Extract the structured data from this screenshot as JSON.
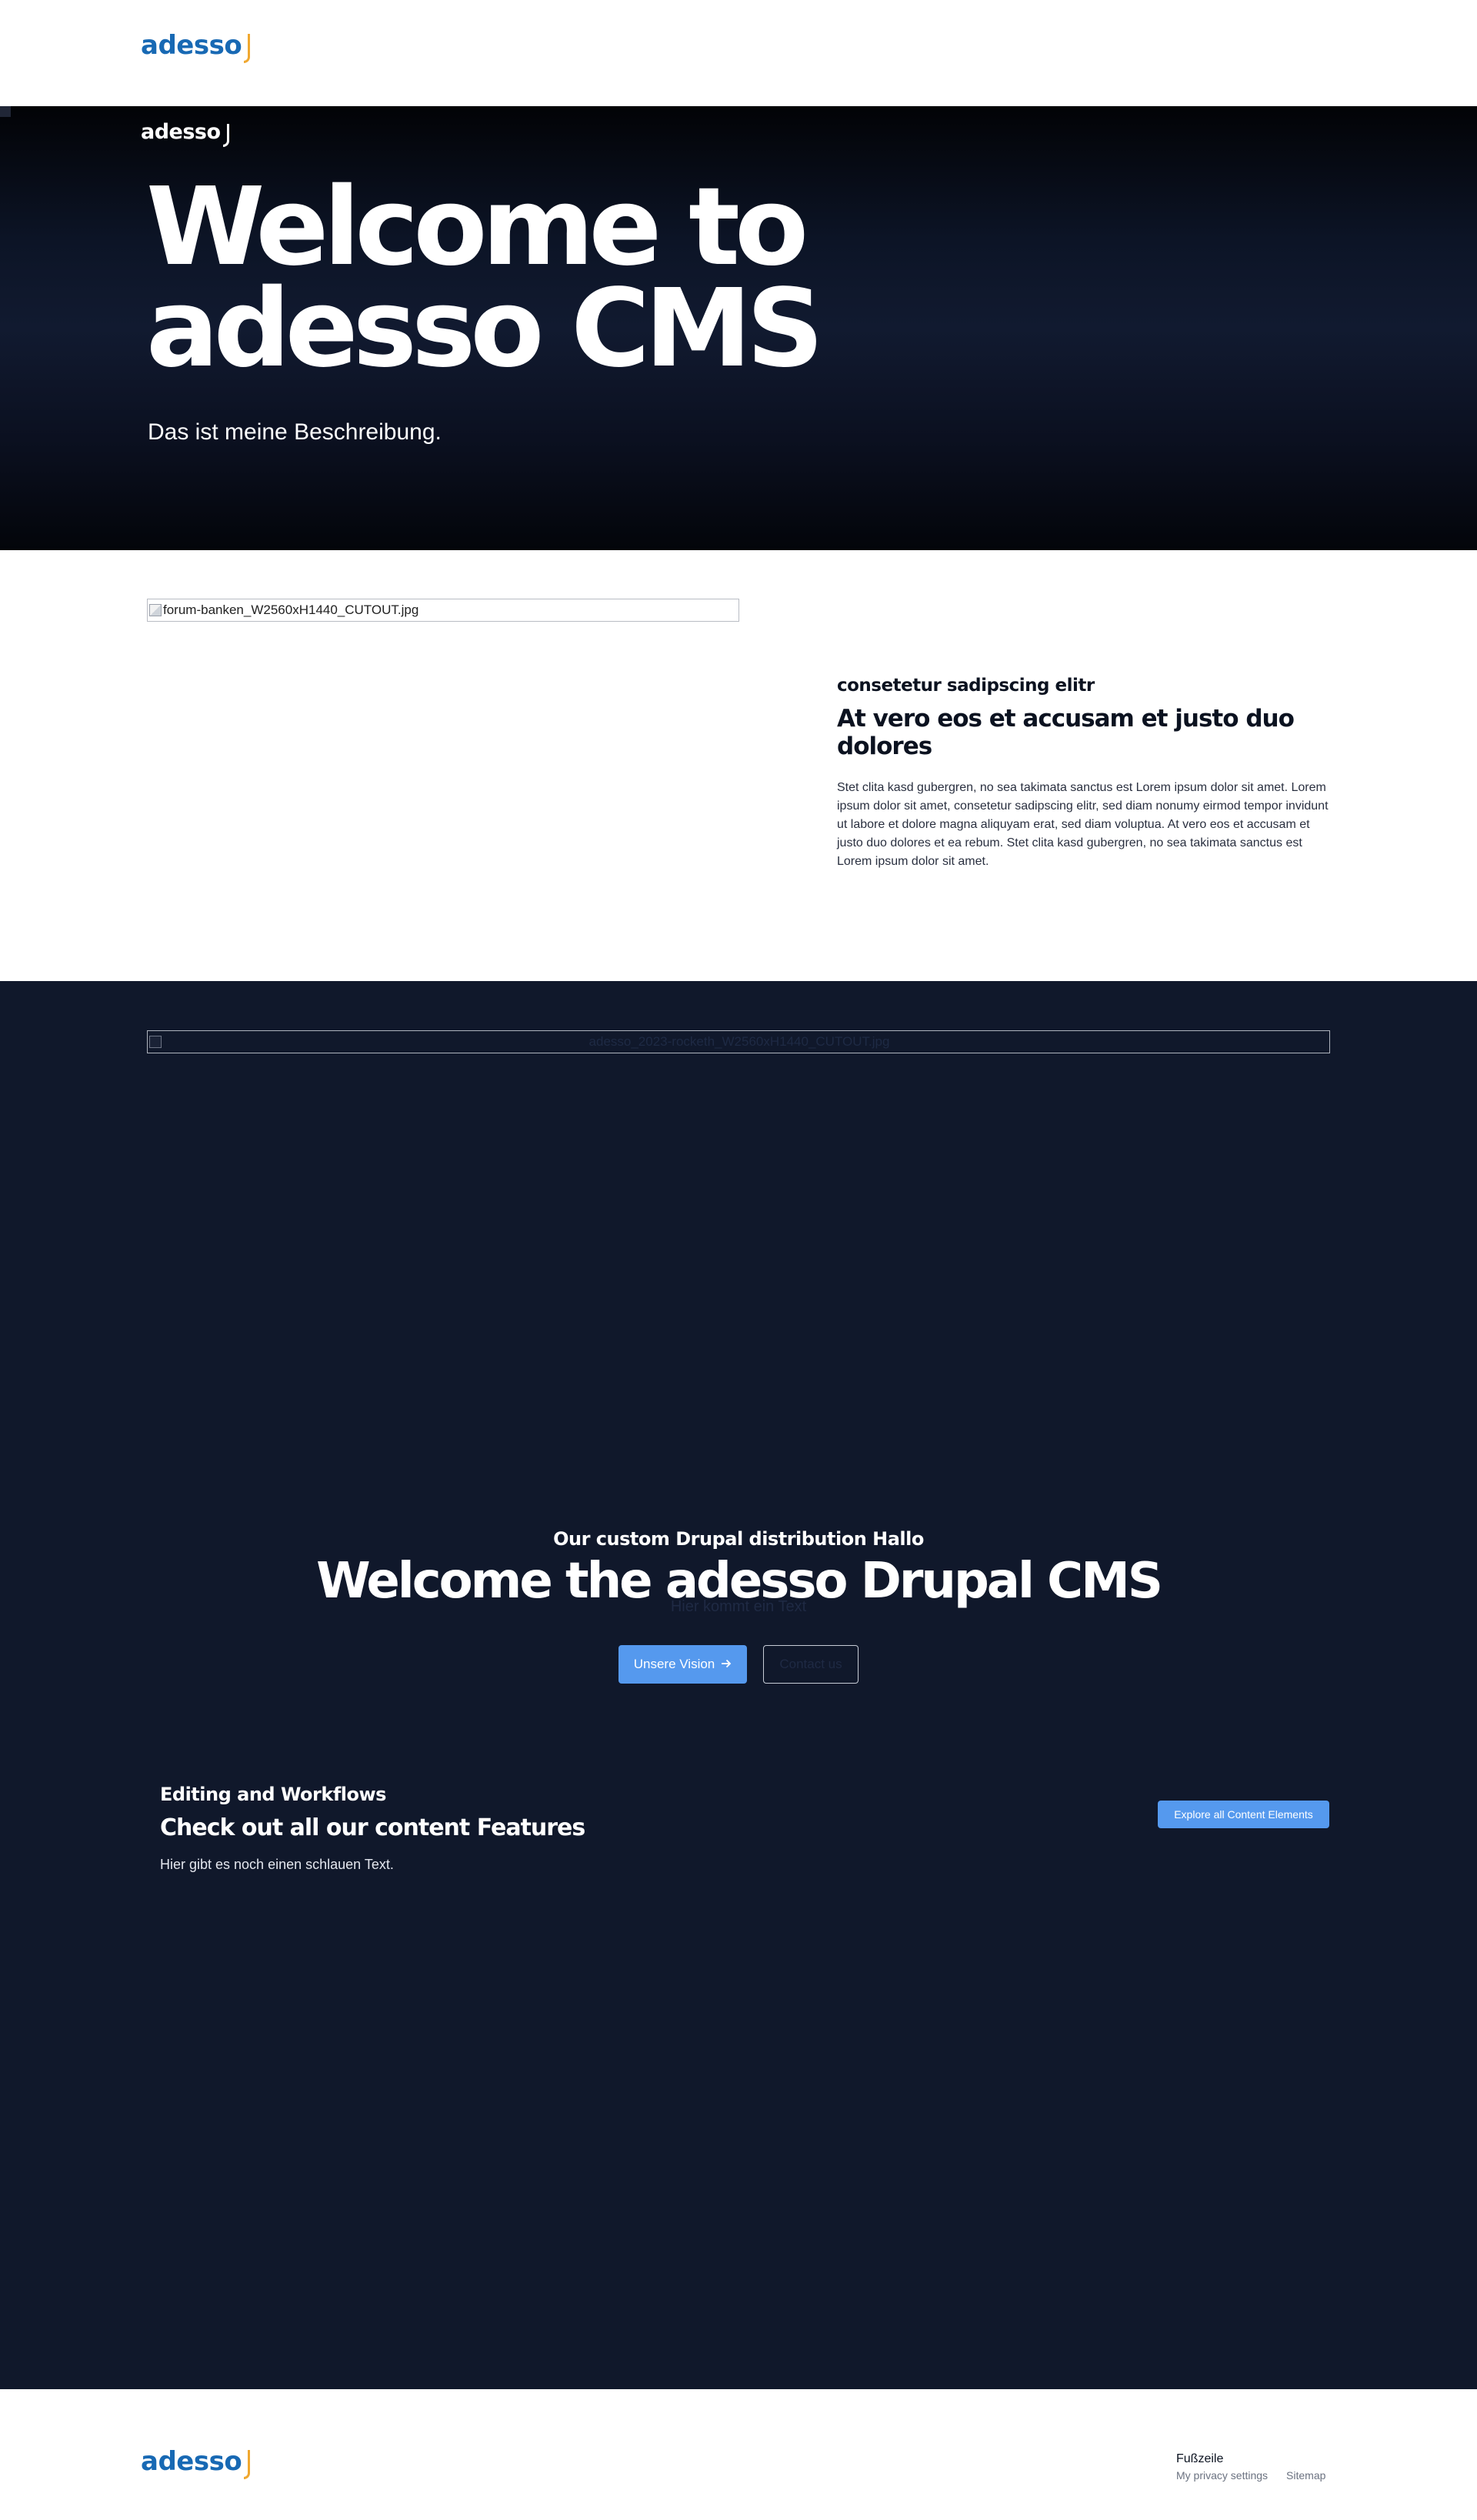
{
  "header": {
    "logo_text": "adesso"
  },
  "hero": {
    "logo_text": "adesso",
    "title_line1": "Welcome to",
    "title_line2": "adesso CMS",
    "description": "Das ist meine Beschreibung."
  },
  "text_media": {
    "image_alt": "forum-banken_W2560xH1440_CUTOUT.jpg",
    "eyebrow": "consetetur sadipscing elitr",
    "heading": "At vero eos et accusam et justo duo dolores",
    "body": "Stet clita kasd gubergren, no sea takimata sanctus est Lorem ipsum dolor sit amet. Lorem ipsum dolor sit amet, consetetur sadipscing elitr, sed diam nonumy eirmod tempor invidunt ut labore et dolore magna aliquyam erat, sed diam voluptua. At vero eos et accusam et justo duo dolores et ea rebum. Stet clita kasd gubergren, no sea takimata sanctus est Lorem ipsum dolor sit amet."
  },
  "dark_section": {
    "image_alt": "adesso_2023-rocketh_W2560xH1440_CUTOUT.jpg",
    "eyebrow": "Our custom Drupal distribution Hallo",
    "title": "Welcome the adesso Drupal CMS",
    "subtitle": "Hier kommt ein Text",
    "primary_button": "Unsere Vision",
    "secondary_button": "Contact us",
    "features": {
      "eyebrow": "Editing and Workflows",
      "heading": "Check out all our content Features",
      "text": "Hier gibt es noch einen schlauen Text.",
      "button": "Explore all Content Elements"
    }
  },
  "footer": {
    "logo_text": "adesso",
    "title": "Fußzeile",
    "links": [
      "My privacy settings",
      "Sitemap"
    ]
  },
  "colors": {
    "brand_blue": "#1869b4",
    "accent_orange": "#f0a830",
    "dark_bg": "#10182b",
    "button_blue": "#5599ee"
  },
  "icons": [
    "broken-image-icon",
    "arrow-right-icon"
  ]
}
